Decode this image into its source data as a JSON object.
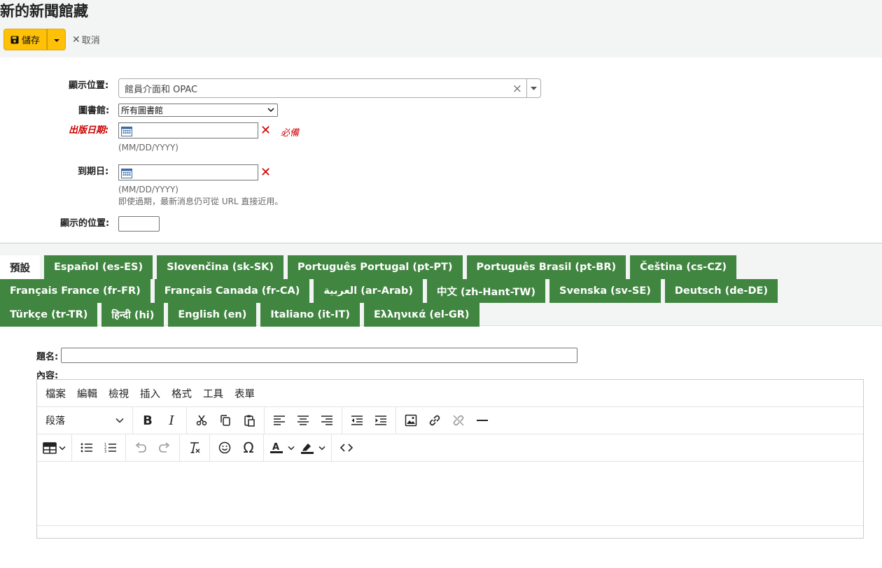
{
  "page": {
    "title": "新的新聞館藏"
  },
  "toolbar": {
    "save_label": "儲存",
    "cancel_label": "取消"
  },
  "form": {
    "display_location": {
      "label": "顯示位置:",
      "value": "館員介面和 OPAC"
    },
    "library": {
      "label": "圖書館:",
      "value": "所有圖書館"
    },
    "publication_date": {
      "label": "出版日期:",
      "value": "",
      "format_hint": "(MM/DD/YYYY)",
      "required_note": "必備"
    },
    "expiration_date": {
      "label": "到期日:",
      "value": "",
      "format_hint": "(MM/DD/YYYY)",
      "note": "即使過期，最新消息仍可從 URL 直接近用。"
    },
    "appear_position": {
      "label": "顯示的位置:",
      "value": ""
    }
  },
  "tabs": {
    "row1": [
      "預設",
      "Español (es-ES)",
      "Slovenčina (sk-SK)",
      "Português Portugal (pt-PT)",
      "Português Brasil (pt-BR)",
      "Čeština (cs-CZ)"
    ],
    "row2": [
      "Français France (fr-FR)",
      "Français Canada (fr-CA)",
      "العربية (ar-Arab)",
      "中文 (zh-Hant-TW)",
      "Svenska (sv-SE)",
      "Deutsch (de-DE)"
    ],
    "row3": [
      "Türkçe (tr-TR)",
      "हिन्दी (hi)",
      "English (en)",
      "Italiano (it-IT)",
      "Ελληνικά (el-GR)"
    ],
    "active": "預設"
  },
  "content": {
    "title_label": "題名:",
    "title_value": "",
    "body_label": "內容:",
    "editor": {
      "menus": [
        "檔案",
        "編輯",
        "檢視",
        "插入",
        "格式",
        "工具",
        "表單"
      ],
      "block_format": "段落"
    }
  },
  "colors": {
    "save_button": "#ffc107",
    "tab_green": "#408540",
    "required_red": "#cc0000",
    "header_bg": "#f3f4f4"
  }
}
